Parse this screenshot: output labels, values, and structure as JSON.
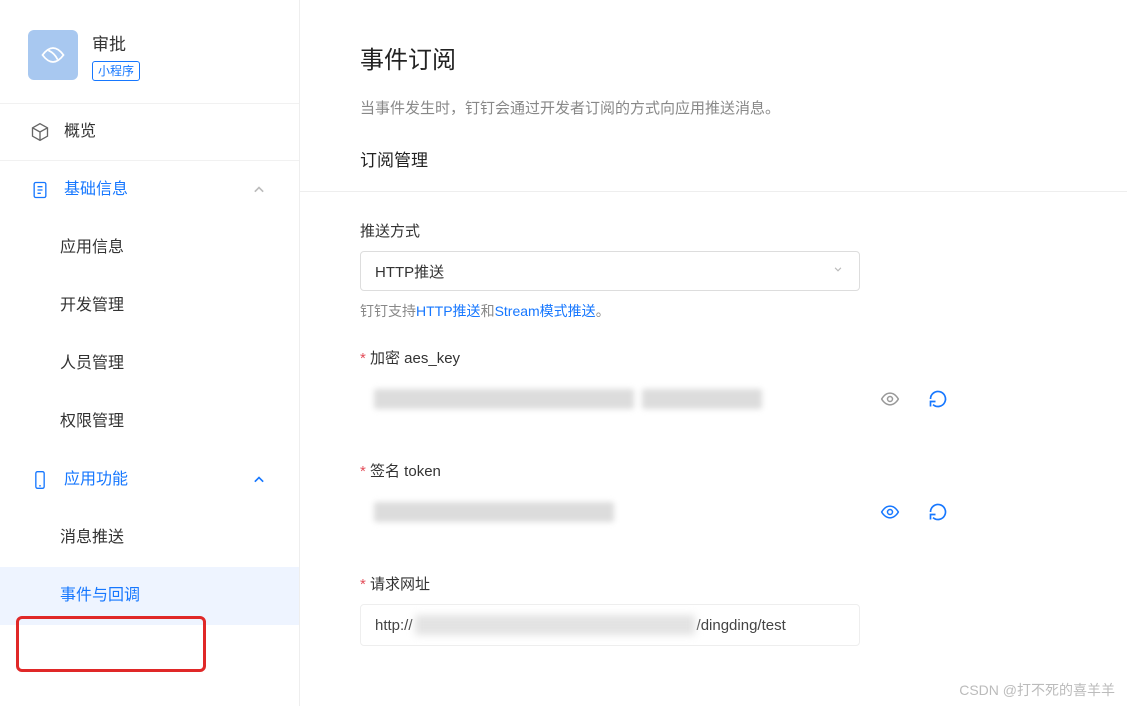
{
  "app": {
    "name": "审批",
    "badge": "小程序"
  },
  "sidebar": {
    "overview": "概览",
    "basic": {
      "label": "基础信息",
      "items": [
        "应用信息",
        "开发管理",
        "人员管理",
        "权限管理"
      ]
    },
    "features": {
      "label": "应用功能",
      "items": [
        "消息推送",
        "事件与回调"
      ]
    }
  },
  "page": {
    "title": "事件订阅",
    "desc": "当事件发生时，钉钉会通过开发者订阅的方式向应用推送消息。",
    "sub_mgmt": "订阅管理",
    "push_method_label": "推送方式",
    "push_method_value": "HTTP推送",
    "help_prefix": "钉钉支持",
    "help_link1": "HTTP推送",
    "help_mid": "和",
    "help_link2": "Stream模式推送",
    "help_suffix": "。",
    "aes_key_label": "加密 aes_key",
    "token_label": "签名 token",
    "url_label": "请求网址",
    "url_prefix": "http://",
    "url_suffix": "/dingding/test",
    "eye_color_gray": "#999",
    "eye_color_blue": "#1677ff",
    "refresh_color": "#1677ff"
  },
  "watermark": "CSDN @打不死的喜羊羊"
}
